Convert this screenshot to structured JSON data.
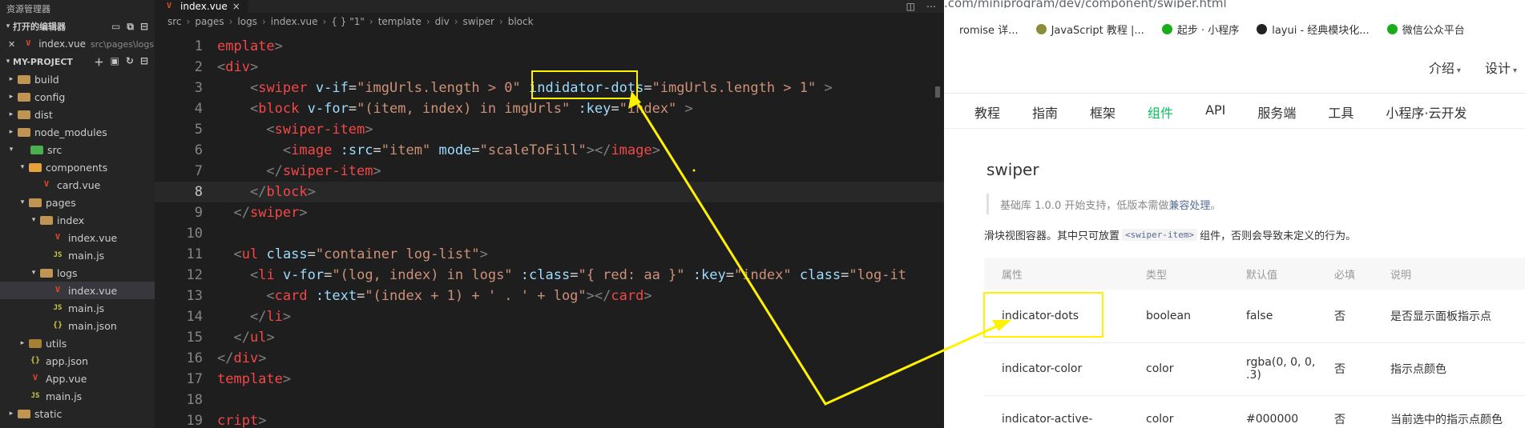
{
  "explorer": {
    "title": "资源管理器",
    "open_editors_label": "打开的编辑器",
    "open_file": {
      "name": "index.vue",
      "path": "src\\pages\\logs"
    },
    "project_label": "MY-PROJECT",
    "tree": [
      {
        "label": "build",
        "kind": "folder",
        "depth": 0,
        "twisty": "▸",
        "icon": "folder-icon"
      },
      {
        "label": "config",
        "kind": "folder",
        "depth": 0,
        "twisty": "▸",
        "icon": "folder-icon"
      },
      {
        "label": "dist",
        "kind": "folder",
        "depth": 0,
        "twisty": "▸",
        "icon": "folder-icon"
      },
      {
        "label": "node_modules",
        "kind": "folder",
        "depth": 0,
        "twisty": "▸",
        "icon": "folder-icon"
      },
      {
        "label": "src",
        "kind": "folder-src",
        "depth": 0,
        "twisty": "▾",
        "icon": "folder-open-icon"
      },
      {
        "label": "components",
        "kind": "folder-comp",
        "depth": 1,
        "twisty": "▾",
        "icon": "folder-open-icon"
      },
      {
        "label": "card.vue",
        "kind": "vue",
        "depth": 2,
        "twisty": "",
        "icon": "vue-file-icon"
      },
      {
        "label": "pages",
        "kind": "folder",
        "depth": 1,
        "twisty": "▾",
        "icon": "folder-open-icon"
      },
      {
        "label": "index",
        "kind": "folder",
        "depth": 2,
        "twisty": "▾",
        "icon": "folder-open-icon"
      },
      {
        "label": "index.vue",
        "kind": "vue",
        "depth": 3,
        "twisty": "",
        "icon": "vue-file-icon"
      },
      {
        "label": "main.js",
        "kind": "js",
        "depth": 3,
        "twisty": "",
        "icon": "js-file-icon"
      },
      {
        "label": "logs",
        "kind": "folder",
        "depth": 2,
        "twisty": "▾",
        "icon": "folder-open-icon"
      },
      {
        "label": "index.vue",
        "kind": "vue",
        "depth": 3,
        "twisty": "",
        "icon": "vue-file-icon",
        "selected": true
      },
      {
        "label": "main.js",
        "kind": "js",
        "depth": 3,
        "twisty": "",
        "icon": "js-file-icon"
      },
      {
        "label": "main.json",
        "kind": "json",
        "depth": 3,
        "twisty": "",
        "icon": "json-file-icon"
      },
      {
        "label": "utils",
        "kind": "folder-utils",
        "depth": 1,
        "twisty": "▸",
        "icon": "folder-icon"
      },
      {
        "label": "app.json",
        "kind": "json",
        "depth": 1,
        "twisty": "",
        "icon": "json-file-icon"
      },
      {
        "label": "App.vue",
        "kind": "vue",
        "depth": 1,
        "twisty": "",
        "icon": "vue-file-icon"
      },
      {
        "label": "main.js",
        "kind": "js",
        "depth": 1,
        "twisty": "",
        "icon": "js-file-icon"
      },
      {
        "label": "static",
        "kind": "folder",
        "depth": 0,
        "twisty": "▸",
        "icon": "folder-icon"
      }
    ]
  },
  "editor": {
    "tab_label": "index.vue",
    "tab_close": "×",
    "breadcrumbs": [
      "src",
      "pages",
      "logs",
      "index.vue",
      "{ } \"1\"",
      "template",
      "div",
      "swiper",
      "block"
    ],
    "active_line": 8,
    "lines": [
      {
        "n": "1",
        "tokens": [
          [
            "t-tag",
            "emplate"
          ],
          [
            "t-br",
            ">"
          ]
        ]
      },
      {
        "n": "2",
        "tokens": [
          [
            "t-br",
            "<"
          ],
          [
            "t-tag",
            "div"
          ],
          [
            "t-br",
            ">"
          ]
        ]
      },
      {
        "n": "3",
        "tokens": [
          [
            "t-txt",
            "    "
          ],
          [
            "t-br",
            "<"
          ],
          [
            "t-tag",
            "swiper"
          ],
          [
            "t-txt",
            " "
          ],
          [
            "t-attr",
            "v-if"
          ],
          [
            "t-txt",
            "="
          ],
          [
            "t-str",
            "\"imgUrls.length > 0\""
          ],
          [
            "t-txt",
            " "
          ],
          [
            "t-attr",
            "indidator-dots"
          ],
          [
            "t-txt",
            "="
          ],
          [
            "t-str",
            "\"imgUrls.length > 1\""
          ],
          [
            "t-txt",
            " "
          ],
          [
            "t-br",
            ">"
          ]
        ]
      },
      {
        "n": "4",
        "tokens": [
          [
            "t-txt",
            "    "
          ],
          [
            "t-br",
            "<"
          ],
          [
            "t-tag",
            "block"
          ],
          [
            "t-txt",
            " "
          ],
          [
            "t-attr",
            "v-for"
          ],
          [
            "t-txt",
            "="
          ],
          [
            "t-str",
            "\"(item, index) in imgUrls\""
          ],
          [
            "t-txt",
            " "
          ],
          [
            "t-attr",
            ":key"
          ],
          [
            "t-txt",
            "="
          ],
          [
            "t-str",
            "\"index\""
          ],
          [
            "t-txt",
            " "
          ],
          [
            "t-br",
            ">"
          ]
        ]
      },
      {
        "n": "5",
        "tokens": [
          [
            "t-txt",
            "      "
          ],
          [
            "t-br",
            "<"
          ],
          [
            "t-tag",
            "swiper-item"
          ],
          [
            "t-br",
            ">"
          ]
        ]
      },
      {
        "n": "6",
        "tokens": [
          [
            "t-txt",
            "        "
          ],
          [
            "t-br",
            "<"
          ],
          [
            "t-tag",
            "image"
          ],
          [
            "t-txt",
            " "
          ],
          [
            "t-attr",
            ":src"
          ],
          [
            "t-txt",
            "="
          ],
          [
            "t-str",
            "\"item\""
          ],
          [
            "t-txt",
            " "
          ],
          [
            "t-attr",
            "mode"
          ],
          [
            "t-txt",
            "="
          ],
          [
            "t-str",
            "\"scaleToFill\""
          ],
          [
            "t-br",
            "></"
          ],
          [
            "t-tag",
            "image"
          ],
          [
            "t-br",
            ">"
          ]
        ]
      },
      {
        "n": "7",
        "tokens": [
          [
            "t-txt",
            "      "
          ],
          [
            "t-br",
            "</"
          ],
          [
            "t-tag",
            "swiper-item"
          ],
          [
            "t-br",
            ">"
          ]
        ]
      },
      {
        "n": "8",
        "tokens": [
          [
            "t-txt",
            "    "
          ],
          [
            "t-br",
            "</"
          ],
          [
            "t-tag",
            "block"
          ],
          [
            "t-br",
            ">"
          ]
        ]
      },
      {
        "n": "9",
        "tokens": [
          [
            "t-txt",
            "  "
          ],
          [
            "t-br",
            "</"
          ],
          [
            "t-tag",
            "swiper"
          ],
          [
            "t-br",
            ">"
          ]
        ]
      },
      {
        "n": "10",
        "tokens": []
      },
      {
        "n": "11",
        "tokens": [
          [
            "t-txt",
            "  "
          ],
          [
            "t-br",
            "<"
          ],
          [
            "t-tag",
            "ul"
          ],
          [
            "t-txt",
            " "
          ],
          [
            "t-attr",
            "class"
          ],
          [
            "t-txt",
            "="
          ],
          [
            "t-str",
            "\"container log-list\""
          ],
          [
            "t-br",
            ">"
          ]
        ]
      },
      {
        "n": "12",
        "tokens": [
          [
            "t-txt",
            "    "
          ],
          [
            "t-br",
            "<"
          ],
          [
            "t-tag",
            "li"
          ],
          [
            "t-txt",
            " "
          ],
          [
            "t-attr",
            "v-for"
          ],
          [
            "t-txt",
            "="
          ],
          [
            "t-str",
            "\"(log, index) in logs\""
          ],
          [
            "t-txt",
            " "
          ],
          [
            "t-attr",
            ":class"
          ],
          [
            "t-txt",
            "="
          ],
          [
            "t-str",
            "\"{ red: aa }\""
          ],
          [
            "t-txt",
            " "
          ],
          [
            "t-attr",
            ":key"
          ],
          [
            "t-txt",
            "="
          ],
          [
            "t-str",
            "\"index\""
          ],
          [
            "t-txt",
            " "
          ],
          [
            "t-attr",
            "class"
          ],
          [
            "t-txt",
            "="
          ],
          [
            "t-str",
            "\"log-it"
          ]
        ]
      },
      {
        "n": "13",
        "tokens": [
          [
            "t-txt",
            "      "
          ],
          [
            "t-br",
            "<"
          ],
          [
            "t-tag",
            "card"
          ],
          [
            "t-txt",
            " "
          ],
          [
            "t-attr",
            ":text"
          ],
          [
            "t-txt",
            "="
          ],
          [
            "t-str",
            "\"(index + 1) + ' . ' + log\""
          ],
          [
            "t-br",
            "></"
          ],
          [
            "t-tag",
            "card"
          ],
          [
            "t-br",
            ">"
          ]
        ]
      },
      {
        "n": "14",
        "tokens": [
          [
            "t-txt",
            "    "
          ],
          [
            "t-br",
            "</"
          ],
          [
            "t-tag",
            "li"
          ],
          [
            "t-br",
            ">"
          ]
        ]
      },
      {
        "n": "15",
        "tokens": [
          [
            "t-txt",
            "  "
          ],
          [
            "t-br",
            "</"
          ],
          [
            "t-tag",
            "ul"
          ],
          [
            "t-br",
            ">"
          ]
        ]
      },
      {
        "n": "16",
        "tokens": [
          [
            "t-br",
            "</"
          ],
          [
            "t-tag",
            "div"
          ],
          [
            "t-br",
            ">"
          ]
        ]
      },
      {
        "n": "17",
        "tokens": [
          [
            "t-tag",
            "template"
          ],
          [
            "t-br",
            ">"
          ]
        ]
      },
      {
        "n": "18",
        "tokens": []
      },
      {
        "n": "19",
        "tokens": [
          [
            "t-tag",
            "cript"
          ],
          [
            "t-br",
            ">"
          ]
        ]
      }
    ]
  },
  "browser": {
    "url": ".com/miniprogram/dev/component/swiper.html",
    "bookmarks": [
      {
        "label": "romise 详...",
        "color": "#ffffff"
      },
      {
        "label": "JavaScript 教程 |...",
        "color": "#8c8c3a"
      },
      {
        "label": "起步 · 小程序",
        "color": "#1aad19"
      },
      {
        "label": "layui - 经典模块化...",
        "color": "#222222"
      },
      {
        "label": "微信公众平台",
        "color": "#1aad19"
      }
    ],
    "top_links": [
      "介绍",
      "设计"
    ],
    "nav": [
      "教程",
      "指南",
      "框架",
      "组件",
      "API",
      "服务端",
      "工具",
      "小程序·云开发"
    ],
    "nav_active": "组件",
    "page_title": "swiper",
    "note_text": "基础库 1.0.0 开始支持，低版本需做",
    "note_link": "兼容处理",
    "note_end": "。",
    "desc_before": "滑块视图容器。其中只可放置",
    "desc_code": "<swiper-item>",
    "desc_after": "组件，否则会导致未定义的行为。",
    "table": {
      "headers": [
        "属性",
        "类型",
        "默认值",
        "必填",
        "说明"
      ],
      "rows": [
        [
          "indicator-dots",
          "boolean",
          "false",
          "否",
          "是否显示面板指示点"
        ],
        [
          "indicator-color",
          "color",
          "rgba(0, 0, 0, .3)",
          "否",
          "指示点颜色"
        ],
        [
          "indicator-active-",
          "color",
          "#000000",
          "否",
          "当前选中的指示点颜色"
        ]
      ]
    }
  },
  "annotation_color": "#fff200"
}
